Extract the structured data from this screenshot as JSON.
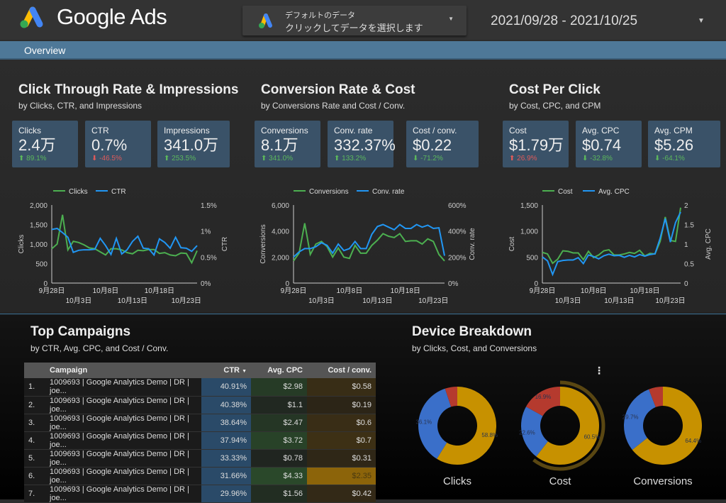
{
  "header": {
    "logo_text": "Google Ads",
    "datasource_line1": "デフォルトのデータ",
    "datasource_line2": "クリックしてデータを選択します",
    "date_range": "2021/09/28 - 2021/10/25"
  },
  "nav": {
    "tab": "Overview"
  },
  "sections": [
    {
      "title": "Click Through Rate & Impressions",
      "subtitle": "by Clicks, CTR, and Impressions"
    },
    {
      "title": "Conversion Rate & Cost",
      "subtitle": "by Conversions Rate and Cost / Conv."
    },
    {
      "title": "Cost Per Click",
      "subtitle": "by Cost, CPC, and CPM"
    }
  ],
  "scorecards": [
    {
      "label": "Clicks",
      "value": "2.4万",
      "change": "89.1%",
      "dir": "up",
      "good": true
    },
    {
      "label": "CTR",
      "value": "0.7%",
      "change": "-46.5%",
      "dir": "down",
      "good": false
    },
    {
      "label": "Impressions",
      "value": "341.0万",
      "change": "253.5%",
      "dir": "up",
      "good": true
    },
    {
      "label": "Conversions",
      "value": "8.1万",
      "change": "341.0%",
      "dir": "up",
      "good": true
    },
    {
      "label": "Conv. rate",
      "value": "332.37%",
      "change": "133.2%",
      "dir": "up",
      "good": true
    },
    {
      "label": "Cost / conv.",
      "value": "$0.22",
      "change": "-71.2%",
      "dir": "down",
      "good": true
    },
    {
      "label": "Cost",
      "value": "$1.79万",
      "change": "26.9%",
      "dir": "up",
      "good": false
    },
    {
      "label": "Avg. CPC",
      "value": "$0.74",
      "change": "-32.8%",
      "dir": "down",
      "good": true
    },
    {
      "label": "Avg. CPM",
      "value": "$5.26",
      "change": "-64.1%",
      "dir": "down",
      "good": true
    }
  ],
  "chart_data": [
    {
      "type": "line",
      "x_ticks_top": [
        "9月28日",
        "10月8日",
        "10月18日"
      ],
      "x_ticks_bottom": [
        "10月3日",
        "10月13日",
        "10月23日"
      ],
      "ylabel": "Clicks",
      "y2label": "CTR",
      "ylim": [
        0,
        2000
      ],
      "yticks": [
        "0",
        "500",
        "1,000",
        "1,500",
        "2,000"
      ],
      "y2lim": [
        0,
        1.5
      ],
      "y2ticks": [
        "0%",
        "0.5%",
        "1%",
        "1.5%"
      ],
      "series": [
        {
          "name": "Clicks",
          "color": "#4caf50",
          "axis": "left",
          "values": [
            880,
            1000,
            1750,
            850,
            1070,
            1040,
            980,
            900,
            880,
            800,
            720,
            880,
            880,
            850,
            780,
            750,
            840,
            830,
            860,
            860,
            760,
            780,
            720,
            700,
            770,
            760,
            520,
            830
          ]
        },
        {
          "name": "CTR",
          "color": "#2196f3",
          "axis": "right",
          "values": [
            1.03,
            1.05,
            0.97,
            0.88,
            0.59,
            0.63,
            0.64,
            0.64,
            0.65,
            0.86,
            0.72,
            0.55,
            0.86,
            0.56,
            0.64,
            0.8,
            0.9,
            0.67,
            0.66,
            0.54,
            0.85,
            0.78,
            0.67,
            0.88,
            0.68,
            0.67,
            0.61,
            0.72
          ]
        }
      ]
    },
    {
      "type": "line",
      "x_ticks_top": [
        "9月28日",
        "10月8日",
        "10月18日"
      ],
      "x_ticks_bottom": [
        "10月3日",
        "10月13日",
        "10月23日"
      ],
      "ylabel": "Conversions",
      "y2label": "Conv. rate",
      "ylim": [
        0,
        6000
      ],
      "yticks": [
        "0",
        "2,000",
        "4,000",
        "6,000"
      ],
      "y2lim": [
        0,
        600
      ],
      "y2ticks": [
        "0%",
        "200%",
        "400%",
        "600%"
      ],
      "series": [
        {
          "name": "Conversions",
          "color": "#4caf50",
          "axis": "left",
          "values": [
            1700,
            2300,
            4600,
            2200,
            3000,
            3200,
            2800,
            2000,
            2700,
            2000,
            1900,
            2900,
            2300,
            2300,
            2900,
            3300,
            3800,
            3600,
            3500,
            3800,
            3200,
            3250,
            3250,
            3000,
            3400,
            3200,
            2200,
            1700
          ]
        },
        {
          "name": "Conv. rate",
          "color": "#2196f3",
          "axis": "right",
          "values": [
            200,
            240,
            265,
            265,
            280,
            310,
            290,
            230,
            300,
            250,
            265,
            320,
            265,
            265,
            375,
            435,
            450,
            430,
            410,
            450,
            420,
            420,
            450,
            430,
            445,
            420,
            425,
            210
          ]
        }
      ]
    },
    {
      "type": "line",
      "x_ticks_top": [
        "9月28日",
        "10月8日",
        "10月18日"
      ],
      "x_ticks_bottom": [
        "10月3日",
        "10月13日",
        "10月23日"
      ],
      "ylabel": "Cost",
      "y2label": "Avg. CPC",
      "ylim": [
        0,
        1500
      ],
      "yticks": [
        "0",
        "500",
        "1,000",
        "1,500"
      ],
      "y2lim": [
        0,
        2
      ],
      "y2ticks": [
        "0",
        "0.5",
        "1",
        "1.5",
        "2"
      ],
      "series": [
        {
          "name": "Cost",
          "color": "#4caf50",
          "axis": "left",
          "values": [
            590,
            560,
            380,
            460,
            620,
            610,
            580,
            580,
            450,
            610,
            490,
            540,
            620,
            640,
            540,
            540,
            560,
            590,
            570,
            630,
            520,
            570,
            560,
            800,
            1270,
            820,
            800,
            1450
          ]
        },
        {
          "name": "Avg. CPC",
          "color": "#2196f3",
          "axis": "right",
          "values": [
            0.67,
            0.57,
            0.22,
            0.55,
            0.58,
            0.59,
            0.59,
            0.65,
            0.5,
            0.72,
            0.68,
            0.62,
            0.7,
            0.74,
            0.7,
            0.71,
            0.66,
            0.71,
            0.67,
            0.73,
            0.69,
            0.73,
            0.75,
            1.15,
            1.65,
            1.05,
            1.55,
            1.82
          ]
        }
      ]
    },
    {
      "type": "table",
      "title": "Top Campaigns",
      "subtitle": "by CTR, Avg. CPC, and Cost / Conv.",
      "columns": [
        "Campaign",
        "CTR",
        "Avg. CPC",
        "Cost / conv."
      ],
      "sort_column": "CTR",
      "sort_dir": "desc",
      "rows": [
        [
          "1.",
          "1009693 | Google Analytics Demo | DR | joe...",
          "40.91%",
          "$2.98",
          "$0.58"
        ],
        [
          "2.",
          "1009693 | Google Analytics Demo | DR | joe...",
          "40.38%",
          "$1.1",
          "$0.19"
        ],
        [
          "3.",
          "1009693 | Google Analytics Demo | DR | joe...",
          "38.64%",
          "$2.47",
          "$0.6"
        ],
        [
          "4.",
          "1009693 | Google Analytics Demo | DR | joe...",
          "37.94%",
          "$3.72",
          "$0.7"
        ],
        [
          "5.",
          "1009693 | Google Analytics Demo | DR | joe...",
          "33.33%",
          "$0.78",
          "$0.31"
        ],
        [
          "6.",
          "1009693 | Google Analytics Demo | DR | joe...",
          "31.66%",
          "$4.33",
          "$2.35"
        ],
        [
          "7.",
          "1009693 | Google Analytics Demo | DR | joe...",
          "29.96%",
          "$1.56",
          "$0.42"
        ]
      ]
    },
    {
      "type": "pie",
      "title": "Device Breakdown",
      "subtitle": "by Clicks, Cost, and Conversions",
      "colors": [
        "#c79100",
        "#3a6fc9",
        "#b53a2e"
      ],
      "charts": [
        {
          "label": "Clicks",
          "values": [
            58.8,
            36.1,
            5.1
          ],
          "labels": [
            "58.8%",
            "36.1%",
            ""
          ]
        },
        {
          "label": "Cost",
          "values": [
            60.5,
            22.6,
            16.9
          ],
          "labels": [
            "60.5%",
            "22.6%",
            "16.9%"
          ],
          "highlighted": 0
        },
        {
          "label": "Conversions",
          "values": [
            64.4,
            29.7,
            5.9
          ],
          "labels": [
            "64.4%",
            "29.7%",
            ""
          ]
        }
      ]
    }
  ]
}
